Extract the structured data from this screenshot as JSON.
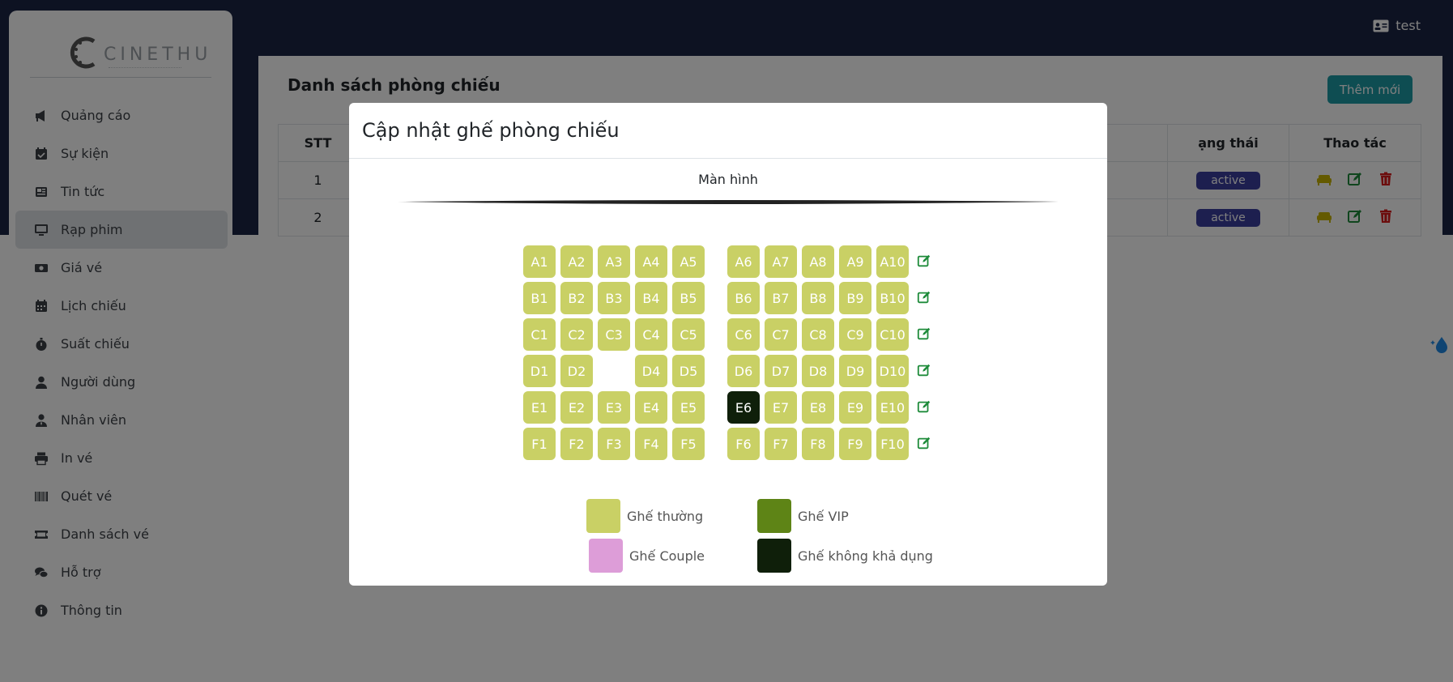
{
  "header": {
    "user_name": "test"
  },
  "sidebar": {
    "logo_text": "CINETHU",
    "items": [
      {
        "label": "Quảng cáo",
        "icon": "megaphone-icon"
      },
      {
        "label": "Sự kiện",
        "icon": "calendar-check-icon"
      },
      {
        "label": "Tin tức",
        "icon": "newspaper-icon"
      },
      {
        "label": "Rạp phim",
        "icon": "desktop-icon"
      },
      {
        "label": "Giá vé",
        "icon": "money-bill-icon"
      },
      {
        "label": "Lịch chiếu",
        "icon": "calendar-icon"
      },
      {
        "label": "Suất chiếu",
        "icon": "stopwatch-icon"
      },
      {
        "label": "Người dùng",
        "icon": "user-icon"
      },
      {
        "label": "Nhân viên",
        "icon": "user-tie-icon"
      },
      {
        "label": "In vé",
        "icon": "printer-icon"
      },
      {
        "label": "Quét vé",
        "icon": "barcode-icon"
      },
      {
        "label": "Danh sách vé",
        "icon": "ticket-icon"
      },
      {
        "label": "Hỗ trợ",
        "icon": "comments-icon"
      },
      {
        "label": "Thông tin",
        "icon": "info-circle-icon"
      }
    ],
    "active_index": 3
  },
  "main": {
    "title": "Danh sách phòng chiếu",
    "add_button": "Thêm mới",
    "table": {
      "headers": [
        "STT",
        "",
        "ạng thái",
        "Thao tác"
      ],
      "rows": [
        {
          "stt": "1",
          "status": "active"
        },
        {
          "stt": "2",
          "status": "active"
        }
      ]
    }
  },
  "modal": {
    "title": "Cập nhật ghế phòng chiếu",
    "screen_label": "Màn hình",
    "rows": [
      {
        "seats": [
          "A1",
          "A2",
          "A3",
          "A4",
          "A5",
          "A6",
          "A7",
          "A8",
          "A9",
          "A10"
        ],
        "disabled": []
      },
      {
        "seats": [
          "B1",
          "B2",
          "B3",
          "B4",
          "B5",
          "B6",
          "B7",
          "B8",
          "B9",
          "B10"
        ],
        "disabled": []
      },
      {
        "seats": [
          "C1",
          "C2",
          "C3",
          "C4",
          "C5",
          "C6",
          "C7",
          "C8",
          "C9",
          "C10"
        ],
        "disabled": []
      },
      {
        "seats": [
          "D1",
          "D2",
          "",
          "D4",
          "D5",
          "D6",
          "D7",
          "D8",
          "D9",
          "D10"
        ],
        "disabled": []
      },
      {
        "seats": [
          "E1",
          "E2",
          "E3",
          "E4",
          "E5",
          "E6",
          "E7",
          "E8",
          "E9",
          "E10"
        ],
        "disabled": [
          "E6"
        ]
      },
      {
        "seats": [
          "F1",
          "F2",
          "F3",
          "F4",
          "F5",
          "F6",
          "F7",
          "F8",
          "F9",
          "F10"
        ],
        "disabled": []
      }
    ],
    "legend": [
      {
        "label": "Ghế thường",
        "color": "#c9d065"
      },
      {
        "label": "Ghế VIP",
        "color": "#5e8416"
      },
      {
        "label": "Ghế Couple",
        "color": "#dd9dd8"
      },
      {
        "label": "Ghế không khả dụng",
        "color": "#0f1f0a"
      }
    ]
  },
  "colors": {
    "topbar": "#1a2444",
    "seat_normal": "#c9d065",
    "seat_disabled": "#0f1f0a",
    "edit_green": "#1e8b3a",
    "delete_red": "#d81b1b",
    "accent_teal": "#1d9aa5",
    "status_badge": "#3b3f9e"
  }
}
